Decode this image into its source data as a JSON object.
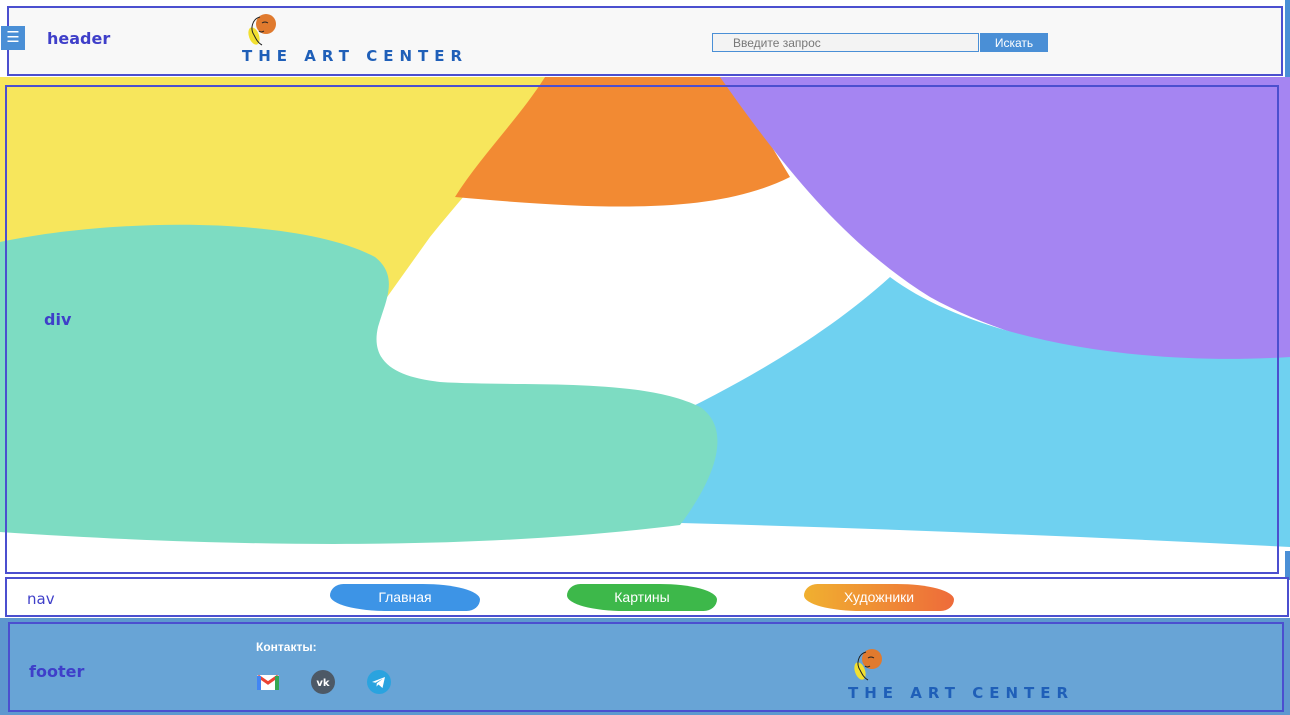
{
  "header": {
    "label": "header",
    "menu_icon": "☰",
    "logo_text": "THE ART CENTER",
    "search": {
      "placeholder": "Введите запрос",
      "button_label": "Искать"
    }
  },
  "hero": {
    "label": "div"
  },
  "nav": {
    "label": "nav",
    "items": [
      {
        "label": "Главная",
        "color": "#3d94e6"
      },
      {
        "label": "Картины",
        "color": "#3db84a"
      },
      {
        "label": "Художники",
        "color": "#f0a030"
      }
    ]
  },
  "footer": {
    "label": "footer",
    "contacts_title": "Контакты:",
    "social_icons": [
      "gmail-icon",
      "vk-icon",
      "telegram-icon"
    ],
    "logo_text": "THE ART CENTER"
  },
  "colors": {
    "accent": "#4a8fd6",
    "outline": "#4b4fcf",
    "footer": "#68a4d6"
  }
}
